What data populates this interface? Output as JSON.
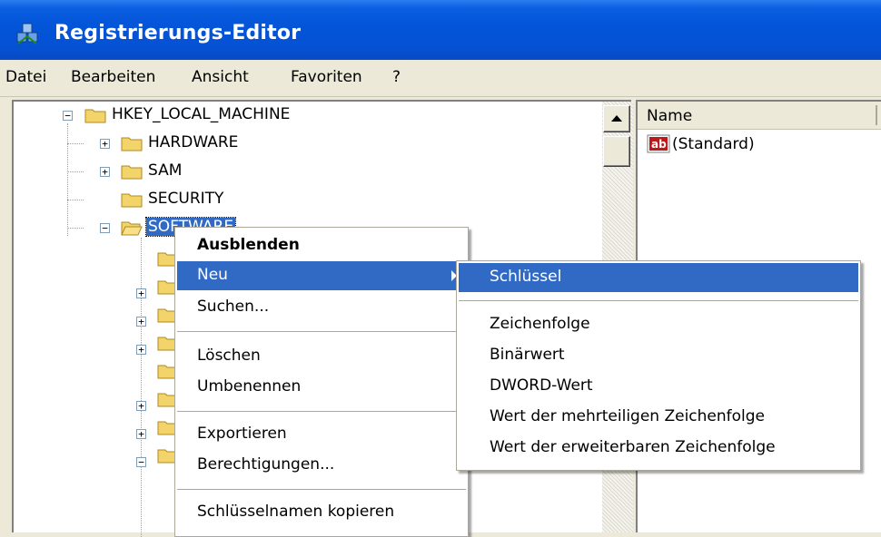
{
  "window": {
    "title": "Registrierungs-Editor"
  },
  "menubar": [
    "Datei",
    "Bearbeiten",
    "Ansicht",
    "Favoriten",
    "?"
  ],
  "tree": {
    "root": "HKEY_LOCAL_MACHINE",
    "children": [
      "HARDWARE",
      "SAM",
      "SECURITY",
      "SOFTWARE"
    ],
    "selected": "SOFTWARE"
  },
  "values_pane": {
    "column_header": "Name",
    "rows": [
      {
        "icon": "string-value-icon",
        "name": "(Standard)"
      }
    ]
  },
  "context_menu": {
    "items": [
      "Ausblenden",
      "Neu",
      "Suchen...",
      "Löschen",
      "Umbenennen",
      "Exportieren",
      "Berechtigungen...",
      "Schlüsselnamen kopieren"
    ],
    "highlighted": "Neu"
  },
  "submenu": {
    "items": [
      "Schlüssel",
      "Zeichenfolge",
      "Binärwert",
      "DWORD-Wert",
      "Wert der mehrteiligen Zeichenfolge",
      "Wert der erweiterbaren Zeichenfolge"
    ],
    "highlighted": "Schlüssel"
  },
  "colors": {
    "titlebar": "#0455d9",
    "highlight": "#316ac5",
    "folder": "#f3d46a"
  }
}
